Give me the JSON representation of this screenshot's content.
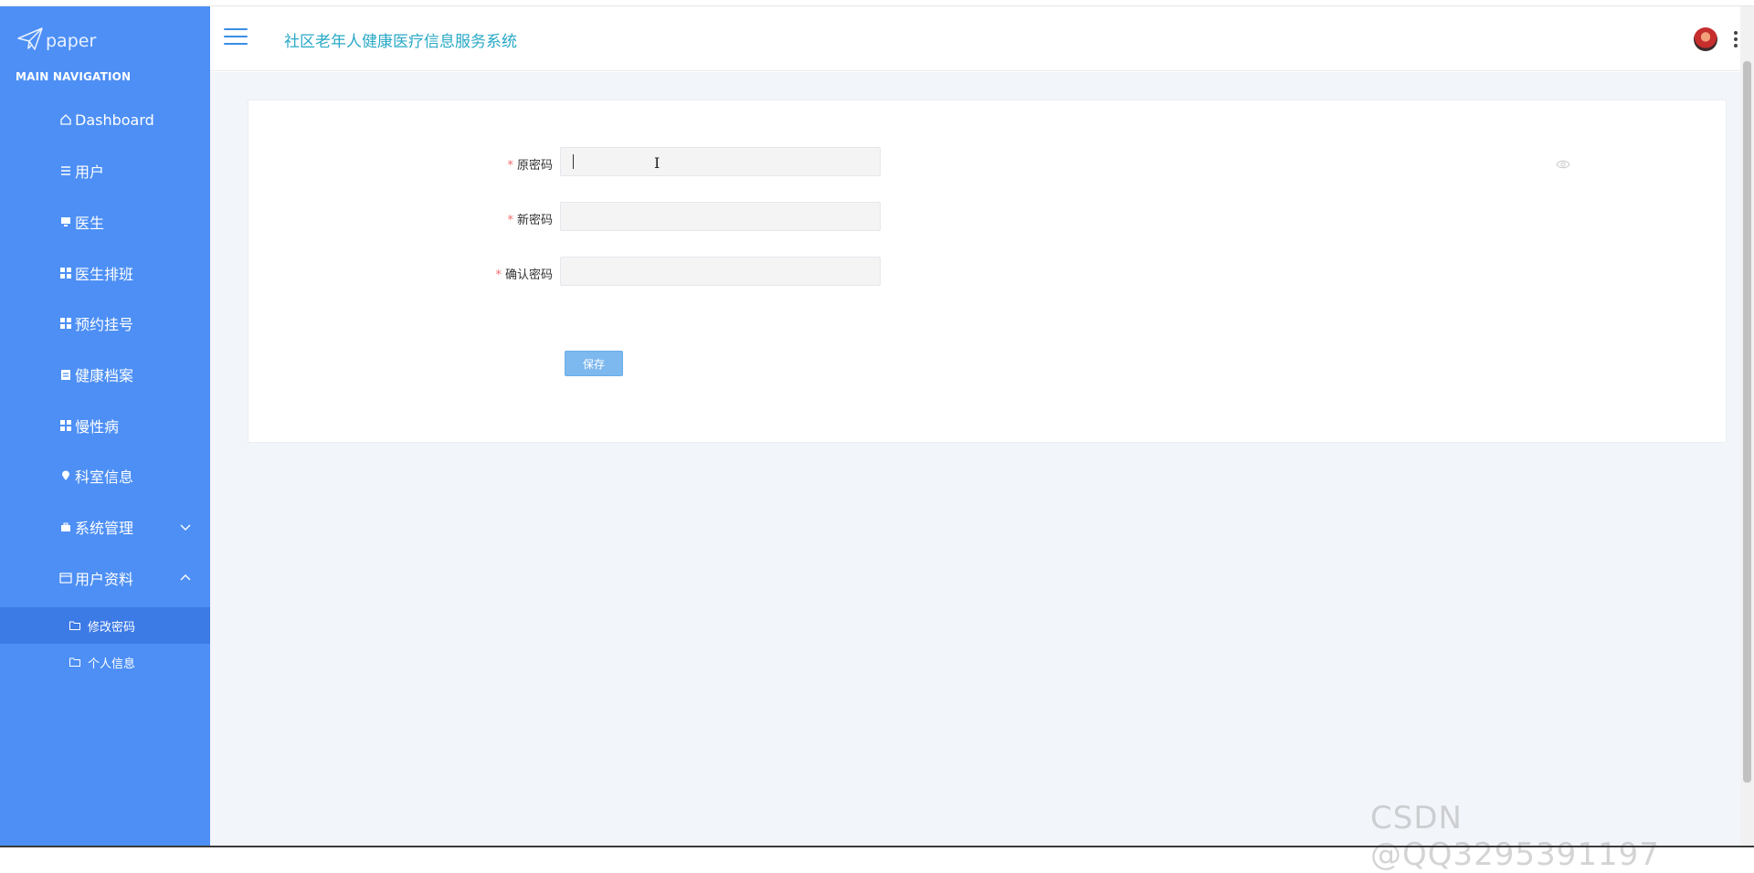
{
  "brand": {
    "name": "paper",
    "icon": "paper-plane-icon"
  },
  "sidebar": {
    "heading": "MAIN NAVIGATION",
    "items": [
      {
        "label": "Dashboard",
        "icon": "home-icon"
      },
      {
        "label": "用户",
        "icon": "list-icon"
      },
      {
        "label": "医生",
        "icon": "monitor-icon"
      },
      {
        "label": "医生排班",
        "icon": "grid-icon"
      },
      {
        "label": "预约挂号",
        "icon": "grid-icon"
      },
      {
        "label": "健康档案",
        "icon": "clipboard-icon"
      },
      {
        "label": "慢性病",
        "icon": "grid-icon"
      },
      {
        "label": "科室信息",
        "icon": "location-icon"
      },
      {
        "label": "系统管理",
        "icon": "briefcase-icon",
        "expanded": false
      },
      {
        "label": "用户资料",
        "icon": "window-icon",
        "expanded": true
      }
    ],
    "sub_items": [
      {
        "label": "修改密码",
        "icon": "folder-icon",
        "active": true
      },
      {
        "label": "个人信息",
        "icon": "folder-icon",
        "active": false
      }
    ]
  },
  "header": {
    "title": "社区老年人健康医疗信息服务系统"
  },
  "form": {
    "fields": [
      {
        "label": "原密码",
        "required": true,
        "value": "",
        "placeholder": ""
      },
      {
        "label": "新密码",
        "required": true,
        "value": "",
        "placeholder": ""
      },
      {
        "label": "确认密码",
        "required": true,
        "value": "",
        "placeholder": ""
      }
    ],
    "required_mark": "*",
    "save_label": "保存"
  },
  "watermark": "CSDN @QQ3295391197",
  "colors": {
    "sidebar": "#4d8ff5",
    "sidebar_active": "#3c7ae6",
    "title": "#29a9c6",
    "button": "#7db8ee",
    "required": "#f56c6c"
  }
}
